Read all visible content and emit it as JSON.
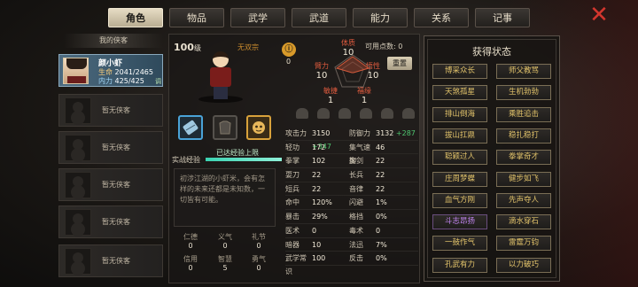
{
  "tabs": [
    "角色",
    "物品",
    "武学",
    "武道",
    "能力",
    "关系",
    "记事"
  ],
  "close_icon": "close-x-icon",
  "colors": {
    "accent_gold": "#e2c36a",
    "accent_purple": "#c084f0",
    "close_red": "#d3362e",
    "exp_bar": "#3bd2b1"
  },
  "companions": {
    "header": "我的侠客",
    "selected": {
      "name": "颜小虾",
      "hp_label": "生命",
      "hp": "2041/2465",
      "mp_label": "内力",
      "mp": "425/425",
      "tag": "调"
    },
    "empty_label": "暂无侠客",
    "empty_slots": 6
  },
  "character": {
    "level": "100",
    "level_unit": "级",
    "sect": "无双宗",
    "fame_icon": "fame-medal-icon",
    "fame_value": "0",
    "exp_label": "实战经验",
    "exp_text": "已达经验上限",
    "exp_progress": 1.0,
    "description": "初涉江湖的小虾米，会有怎样的未来还都是未知数，一切皆有可能。",
    "equipment": [
      "weapon-scroll-icon",
      "armor-icon",
      "accessory-mask-icon"
    ],
    "virtues": [
      {
        "name": "仁德",
        "value": "0"
      },
      {
        "name": "义气",
        "value": "0"
      },
      {
        "name": "礼节",
        "value": "0"
      },
      {
        "name": "信用",
        "value": "0"
      },
      {
        "name": "智慧",
        "value": "5"
      },
      {
        "name": "勇气",
        "value": "0"
      }
    ]
  },
  "attributes": {
    "points_label": "可用点数:",
    "points": "0",
    "reset_label": "重置",
    "items": [
      {
        "name": "体质",
        "value": "10"
      },
      {
        "name": "悟性",
        "value": "10"
      },
      {
        "name": "福缘",
        "value": "1"
      },
      {
        "name": "敏捷",
        "value": "1"
      },
      {
        "name": "臂力",
        "value": "10"
      }
    ]
  },
  "stats": [
    [
      "攻击力",
      "3150",
      "+347",
      "防御力",
      "3132",
      "+287"
    ],
    [
      "轻功",
      "172",
      "",
      "集气速度",
      "46",
      ""
    ],
    [
      "拳掌",
      "102",
      "",
      "御剑",
      "22",
      ""
    ],
    [
      "耍刀",
      "22",
      "",
      "长兵",
      "22",
      ""
    ],
    [
      "短兵",
      "22",
      "",
      "音律",
      "22",
      ""
    ],
    [
      "命中",
      "120%",
      "",
      "闪避",
      "1%",
      ""
    ],
    [
      "暴击",
      "29%",
      "",
      "格挡",
      "0%",
      ""
    ],
    [
      "医术",
      "0",
      "",
      "毒术",
      "0",
      ""
    ],
    [
      "暗器",
      "10",
      "",
      "法迅",
      "7%",
      ""
    ],
    [
      "武学常识",
      "100",
      "",
      "反击",
      "0%",
      ""
    ]
  ],
  "status_panel": {
    "title": "获得状态",
    "tags": [
      {
        "label": "博采众长",
        "color": "gold"
      },
      {
        "label": "师父教骂",
        "color": "gold"
      },
      {
        "label": "天煞孤星",
        "color": "gold"
      },
      {
        "label": "生机勃勃",
        "color": "gold"
      },
      {
        "label": "排山倒海",
        "color": "gold"
      },
      {
        "label": "乘胜追击",
        "color": "gold"
      },
      {
        "label": "拔山扛鼎",
        "color": "gold"
      },
      {
        "label": "稳扎稳打",
        "color": "gold"
      },
      {
        "label": "聪颖过人",
        "color": "gold"
      },
      {
        "label": "拳掌奇才",
        "color": "gold"
      },
      {
        "label": "庄周梦蝶",
        "color": "gold"
      },
      {
        "label": "健步如飞",
        "color": "gold"
      },
      {
        "label": "血气方刚",
        "color": "gold"
      },
      {
        "label": "先声夺人",
        "color": "gold"
      },
      {
        "label": "斗志昂扬",
        "color": "purple"
      },
      {
        "label": "滴水穿石",
        "color": "gold"
      },
      {
        "label": "一鼓作气",
        "color": "gold"
      },
      {
        "label": "雷霆万钧",
        "color": "gold"
      },
      {
        "label": "孔武有力",
        "color": "gold"
      },
      {
        "label": "以力破巧",
        "color": "gold"
      }
    ]
  }
}
